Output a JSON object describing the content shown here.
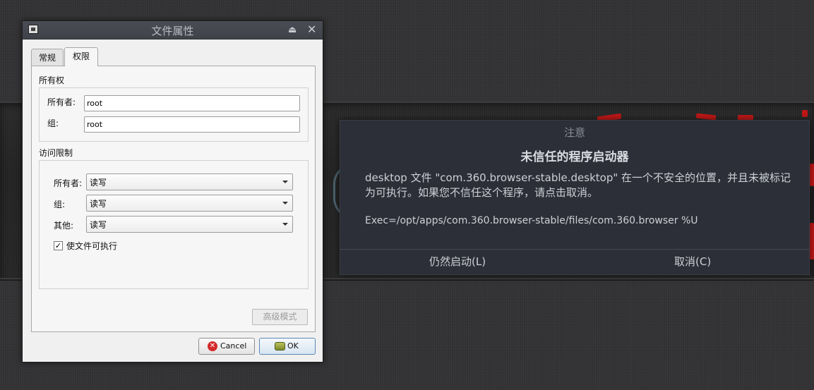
{
  "properties_window": {
    "title": "文件属性",
    "tabs": [
      {
        "label": "常规",
        "active": false
      },
      {
        "label": "权限",
        "active": true
      }
    ],
    "ownership": {
      "section_label": "所有权",
      "owner_label": "所有者:",
      "owner_value": "root",
      "group_label": "组:",
      "group_value": "root"
    },
    "access": {
      "section_label": "访问限制",
      "owner_label": "所有者:",
      "owner_value": "读写",
      "group_label": "组:",
      "group_value": "读写",
      "other_label": "其他:",
      "other_value": "读写",
      "executable_label": "使文件可执行",
      "executable_checked": true,
      "advanced_label": "高级模式"
    },
    "buttons": {
      "cancel_label": "Cancel",
      "ok_label": "OK"
    }
  },
  "warning_dialog": {
    "title": "注意",
    "heading": "未信任的程序启动器",
    "body": "desktop 文件 \"com.360.browser-stable.desktop\" 在一个不安全的位置，并且未被标记为可执行。如果您不信任这个程序，请点击取消。",
    "exec_line": "Exec=/opt/apps/com.360.browser-stable/files/com.360.browser %U",
    "launch_label": "仍然启动(L)",
    "cancel_label": "取消(C)"
  },
  "colors": {
    "desktop_bg": "#333335",
    "dialog_bg": "#2c2f38",
    "wallpaper_red": "#c31818"
  }
}
